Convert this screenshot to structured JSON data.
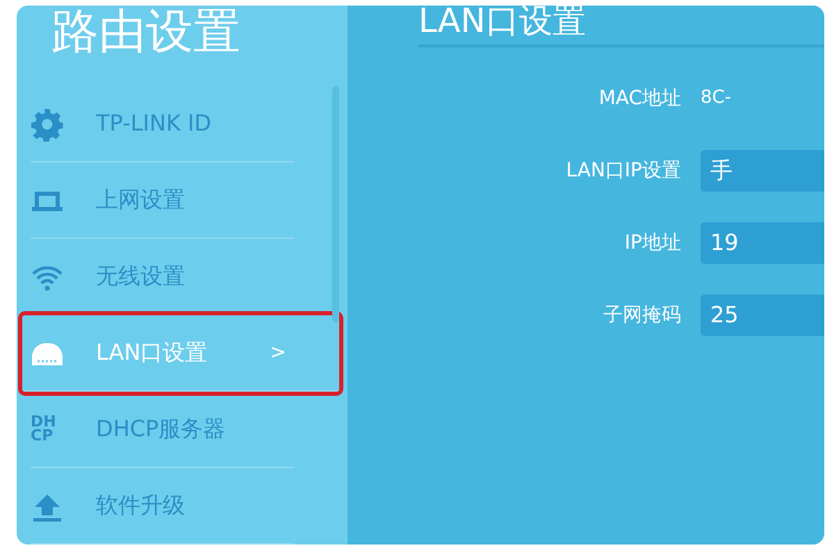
{
  "sidebar": {
    "title": "路由设置",
    "items": [
      {
        "kind": "gear",
        "label": "TP-LINK ID",
        "selected": false,
        "highlighted": false
      },
      {
        "kind": "laptop",
        "label": "上网设置",
        "selected": false,
        "highlighted": false
      },
      {
        "kind": "wifi",
        "label": "无线设置",
        "selected": false,
        "highlighted": false
      },
      {
        "kind": "router",
        "label": "LAN口设置",
        "selected": true,
        "highlighted": true,
        "caret": ">"
      },
      {
        "kind": "text",
        "icon_text": [
          "DH",
          "CP"
        ],
        "label": "DHCP服务器",
        "selected": false,
        "highlighted": false
      },
      {
        "kind": "upload",
        "label": "软件升级",
        "selected": false,
        "highlighted": false
      }
    ]
  },
  "main": {
    "title": "LAN口设置",
    "fields": [
      {
        "kind": "text",
        "label": "MAC地址",
        "value": "8C-"
      },
      {
        "kind": "select",
        "label": "LAN口IP设置",
        "value": "手"
      },
      {
        "kind": "input",
        "label": "IP地址",
        "value": "19"
      },
      {
        "kind": "input",
        "label": "子网掩码",
        "value": "25"
      }
    ]
  }
}
